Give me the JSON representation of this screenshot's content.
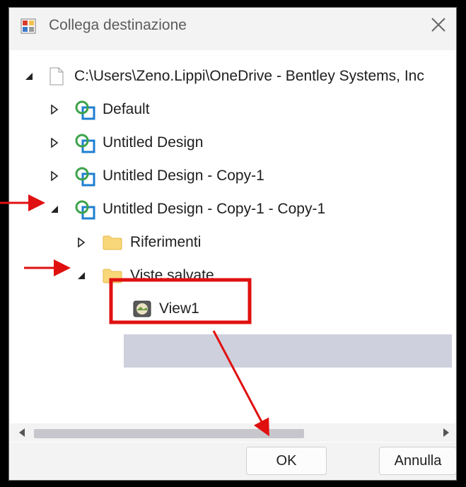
{
  "dialog": {
    "title": "Collega destinazione",
    "close_icon": "close-icon"
  },
  "tree": {
    "root": {
      "label": "C:\\Users\\Zeno.Lippi\\OneDrive - Bentley Systems, Inc",
      "expanded": true
    },
    "models": [
      {
        "label": "Default",
        "expanded": false
      },
      {
        "label": "Untitled Design",
        "expanded": false
      },
      {
        "label": "Untitled Design - Copy-1",
        "expanded": false
      },
      {
        "label": "Untitled Design - Copy-1 - Copy-1",
        "expanded": true
      }
    ],
    "folders": [
      {
        "label": "Riferimenti",
        "expanded": false
      },
      {
        "label": "Viste salvate",
        "expanded": true
      }
    ],
    "views": [
      {
        "label": "View1",
        "selected": true
      }
    ]
  },
  "buttons": {
    "ok": "OK",
    "cancel": "Annulla"
  },
  "colors": {
    "selection": "#cfd0dd",
    "annotation": "#e01010",
    "model_green": "#3da34a",
    "model_blue": "#1f7fd1",
    "folder": "#f7d778"
  }
}
